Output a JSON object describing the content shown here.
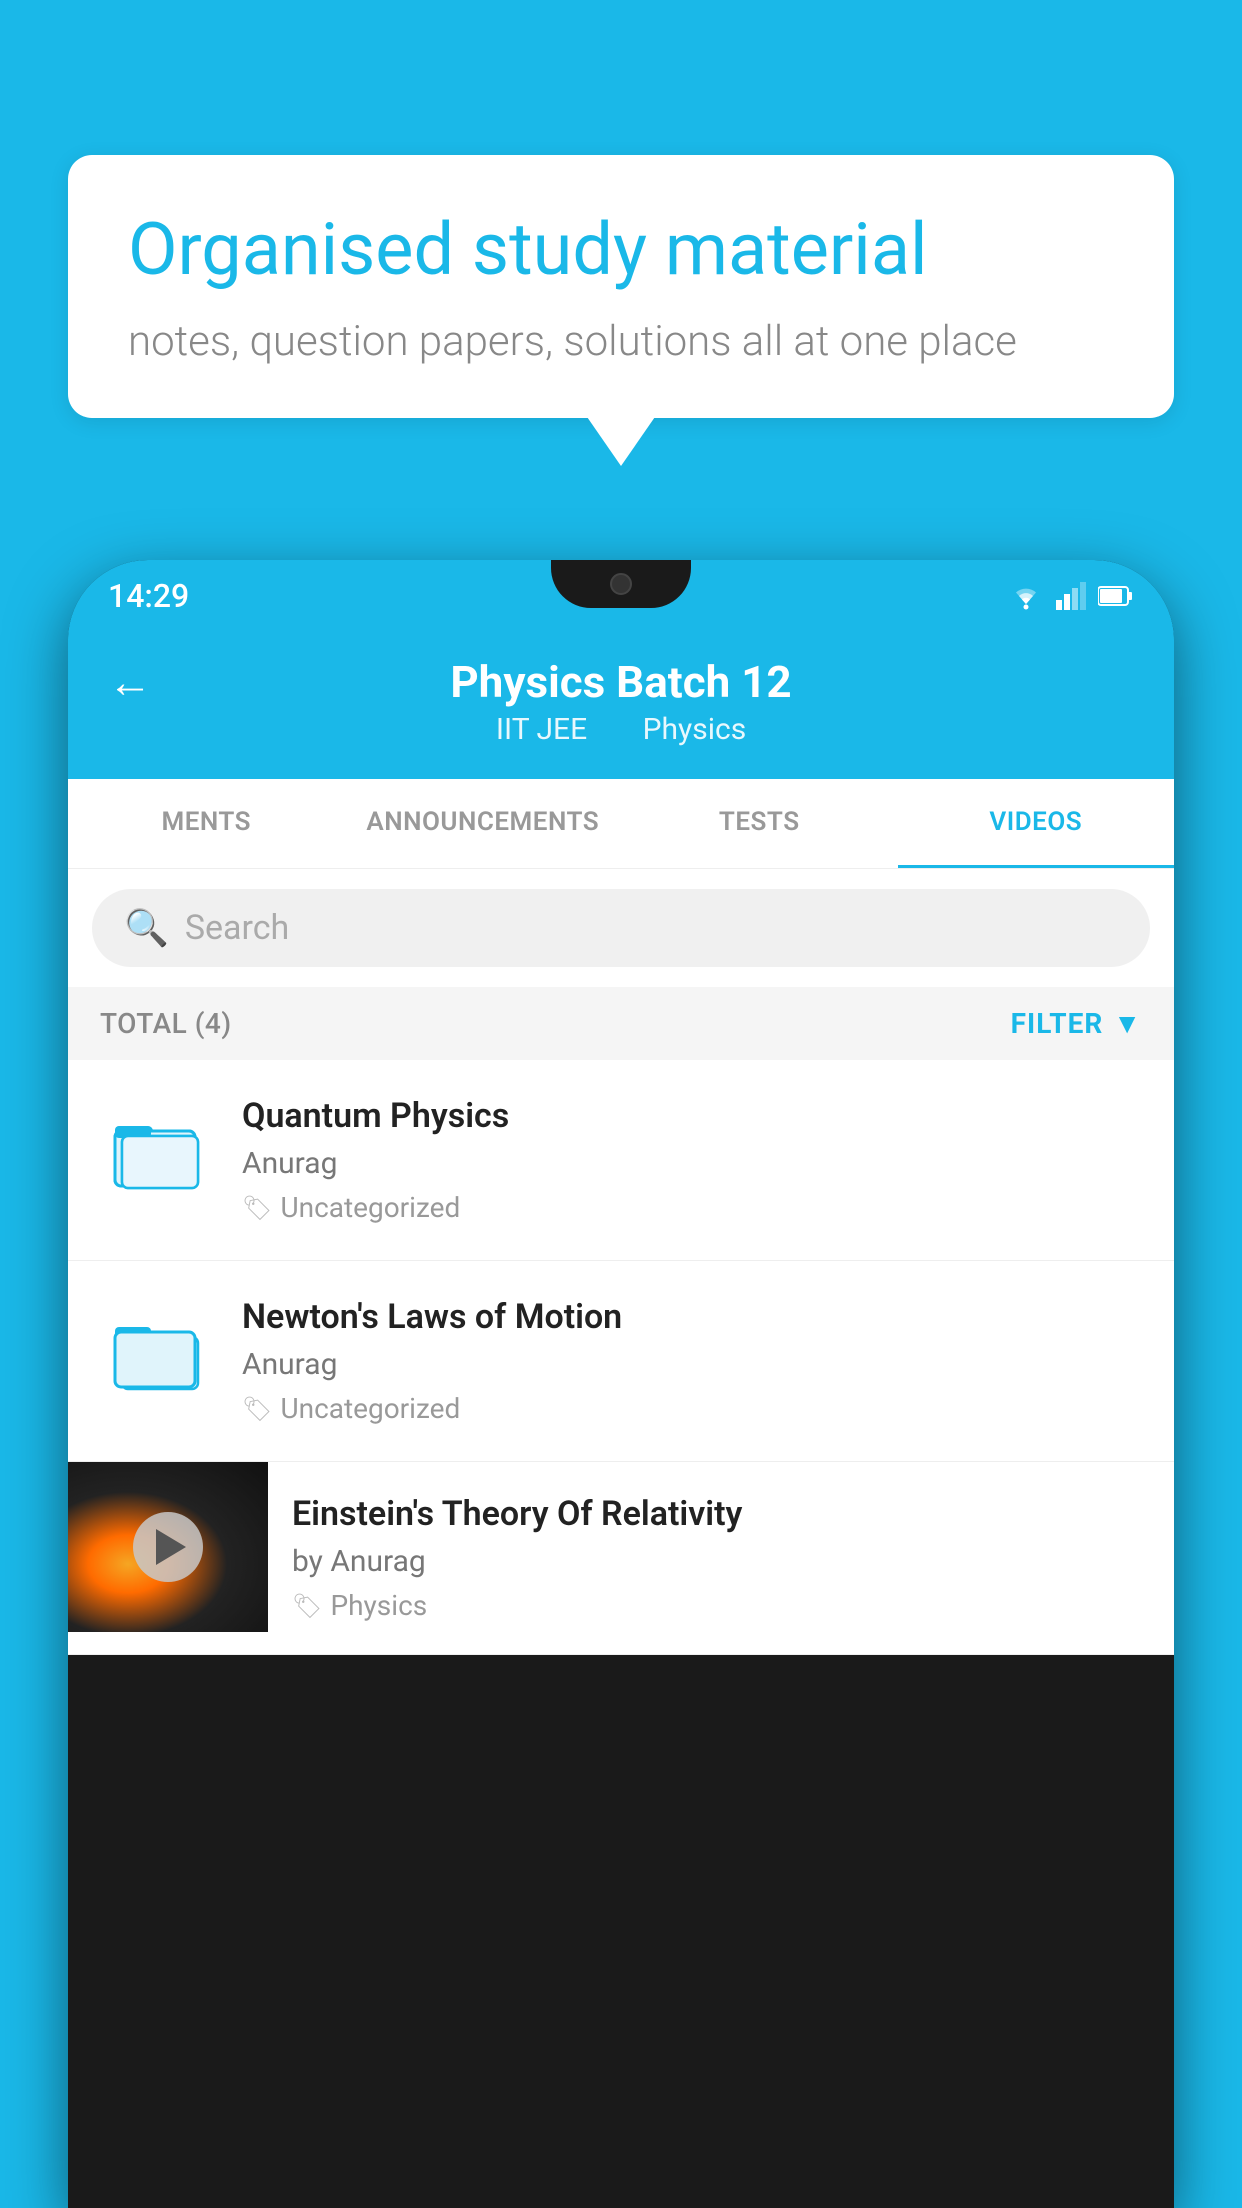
{
  "background_color": "#1ab8e8",
  "hero": {
    "title": "Organised study material",
    "subtitle": "notes, question papers, solutions all at one place"
  },
  "status_bar": {
    "time": "14:29"
  },
  "app_bar": {
    "title": "Physics Batch 12",
    "subtitle1": "IIT JEE",
    "subtitle2": "Physics",
    "back_label": "←"
  },
  "tabs": [
    {
      "label": "MENTS",
      "active": false
    },
    {
      "label": "ANNOUNCEMENTS",
      "active": false
    },
    {
      "label": "TESTS",
      "active": false
    },
    {
      "label": "VIDEOS",
      "active": true
    }
  ],
  "search": {
    "placeholder": "Search"
  },
  "filter_row": {
    "total_label": "TOTAL (4)",
    "filter_label": "FILTER"
  },
  "videos": [
    {
      "id": 1,
      "title": "Quantum Physics",
      "author": "Anurag",
      "tag": "Uncategorized",
      "has_thumbnail": false
    },
    {
      "id": 2,
      "title": "Newton's Laws of Motion",
      "author": "Anurag",
      "tag": "Uncategorized",
      "has_thumbnail": false
    },
    {
      "id": 3,
      "title": "Einstein's Theory Of Relativity",
      "author": "by Anurag",
      "tag": "Physics",
      "has_thumbnail": true
    }
  ]
}
